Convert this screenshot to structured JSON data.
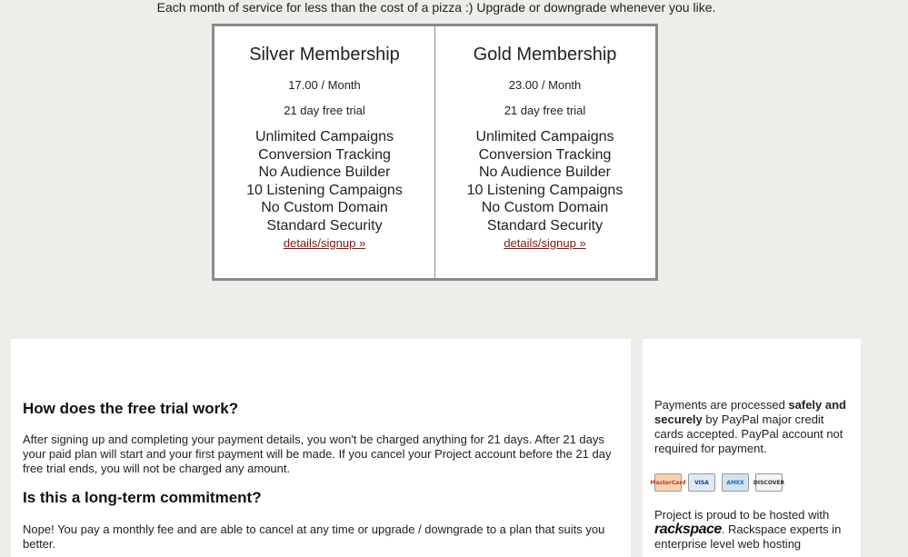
{
  "header": {
    "tagline": "Each month of service for less than the cost of a pizza :) Upgrade or downgrade whenever you like."
  },
  "plans": [
    {
      "name": "Silver Membership",
      "price": "17.00",
      "period": "/ Month",
      "trial": "21 day free trial",
      "features": [
        "Unlimited Campaigns",
        "Conversion Tracking",
        "No Audience Builder",
        "10 Listening Campaigns",
        "No Custom Domain",
        "Standard Security"
      ],
      "signup_label": "details/signup »"
    },
    {
      "name": "Gold Membership",
      "price": "23.00",
      "period": "/ Month",
      "trial": "21 day free trial",
      "features": [
        "Unlimited Campaigns",
        "Conversion Tracking",
        "No Audience Builder",
        "10 Listening Campaigns",
        "No Custom Domain",
        "Standard Security"
      ],
      "signup_label": "details/signup »"
    }
  ],
  "faq": {
    "q1": "How does the free trial work?",
    "a1": "After signing up and completing your payment details, you won't be charged anything for 21 days. After 21 days your paid plan will start and your first payment will be made. If you cancel your Project account before the 21 day free trial ends, you will not be charged any amount.",
    "q2": "Is this a long-term commitment?",
    "a2": "Nope! You pay a monthly fee and are able to cancel at any time or upgrade / downgrade to a plan that suits you better."
  },
  "sidebar": {
    "pay_prefix": "Payments are processed ",
    "pay_bold": "safely and securely",
    "pay_suffix": " by PayPal major credit cards accepted. PayPal account not required for payment.",
    "cards": [
      {
        "label": "MasterCard",
        "bg": "#f7d3b0",
        "fg": "#c0392b"
      },
      {
        "label": "VISA",
        "bg": "#dfe8f4",
        "fg": "#1a3e8c"
      },
      {
        "label": "AMEX",
        "bg": "#cfe3f3",
        "fg": "#2a6fb0"
      },
      {
        "label": "DISCOVER",
        "bg": "#f4f4f4",
        "fg": "#333"
      }
    ],
    "hosted_prefix": "Project is proud to be hosted with",
    "hosted_brand": "rackspace",
    "hosted_suffix": ". Rackspace experts in enterprise level web hosting"
  }
}
